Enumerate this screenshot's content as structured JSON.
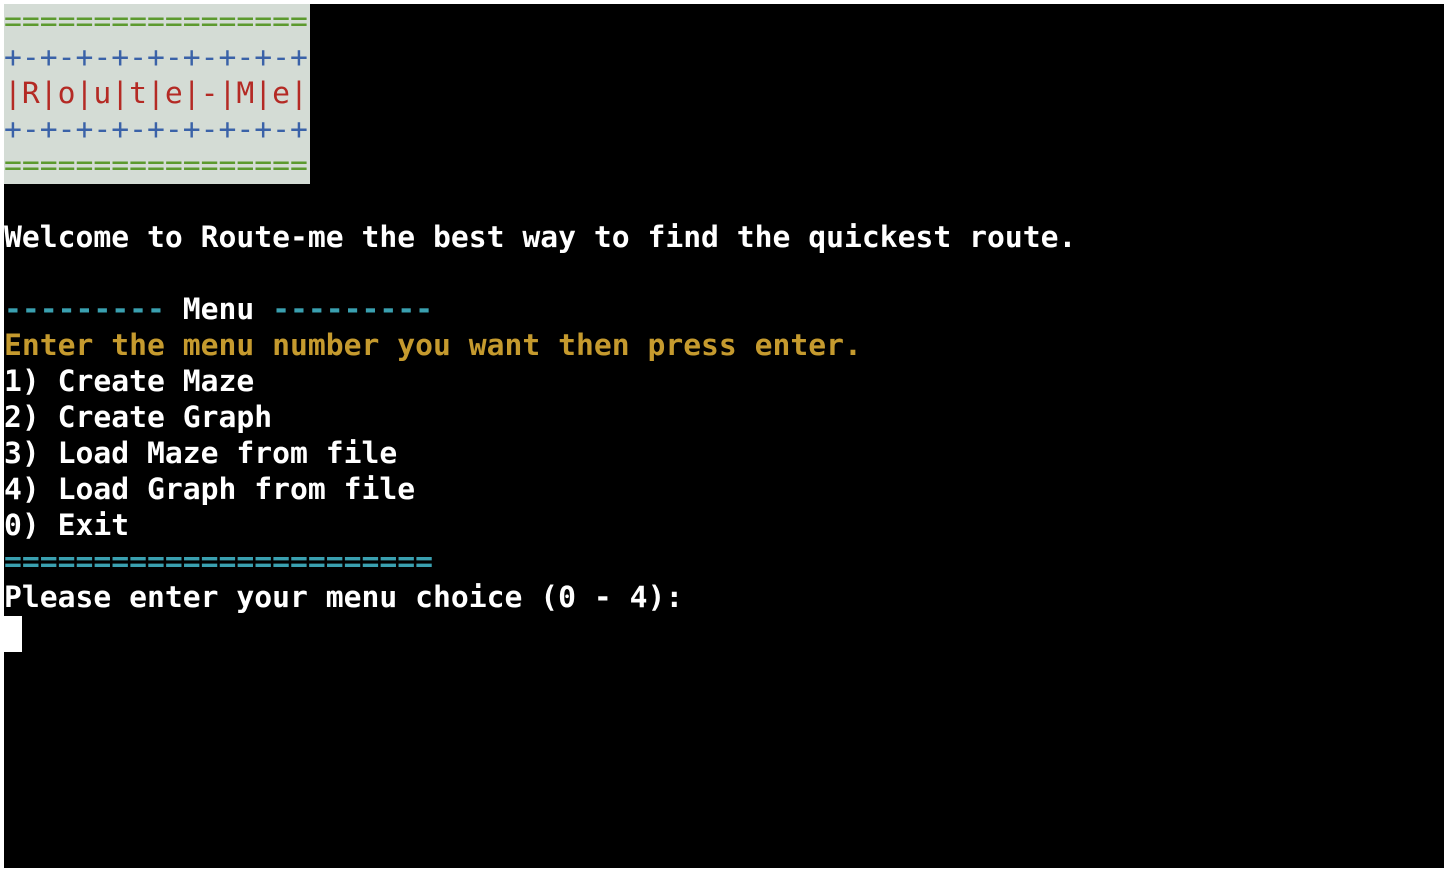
{
  "banner": {
    "border_top": "=================",
    "deco_top": "+-+-+-+-+-+-+-+-+",
    "title": "|R|o|u|t|e|-|M|e|",
    "deco_bottom": "+-+-+-+-+-+-+-+-+",
    "border_bottom": "================="
  },
  "welcome": "Welcome to Route-me the best way to find the quickest route.",
  "menu": {
    "dash_left": "---------",
    "title": " Menu ",
    "dash_right": "---------",
    "instruction": "Enter the menu number you want then press enter.",
    "items": [
      "1) Create Maze",
      "2) Create Graph",
      "3) Load Maze from file",
      "4) Load Graph from file",
      "0) Exit"
    ],
    "separator": "========================"
  },
  "prompt": "Please enter your menu choice (0 - 4):",
  "colors": {
    "terminal_bg": "#000000",
    "banner_bg": "#d4dcd5",
    "banner_border": "#5c9a2e",
    "banner_deco": "#3a62a8",
    "banner_title": "#b42a24",
    "menu_accent": "#3aa0b0",
    "instruction": "#c59a2e",
    "text": "#ffffff"
  }
}
